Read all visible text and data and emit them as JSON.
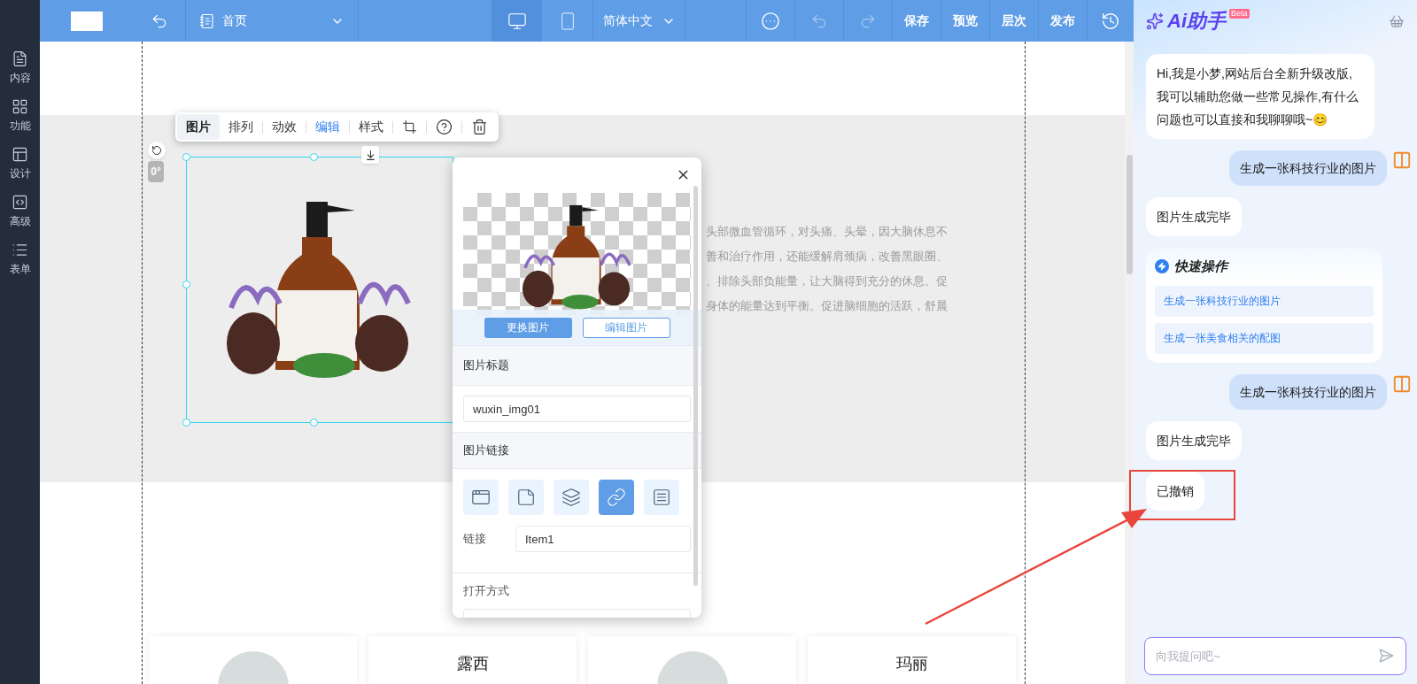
{
  "topbar": {
    "page_select": {
      "label": "首页"
    },
    "devices": [
      {
        "kind": "desktop",
        "selected": true
      },
      {
        "kind": "mobile",
        "selected": false
      }
    ],
    "language": "简体中文",
    "history": [
      {
        "kind": "undo",
        "disabled": true
      },
      {
        "kind": "redo",
        "disabled": true
      }
    ],
    "actions": [
      "保存",
      "预览",
      "层次",
      "发布"
    ]
  },
  "sidebar": {
    "items": [
      {
        "kind": "content",
        "label": "内容"
      },
      {
        "kind": "feature",
        "label": "功能"
      },
      {
        "kind": "design",
        "label": "设计"
      },
      {
        "kind": "advanced",
        "label": "高级"
      },
      {
        "kind": "form",
        "label": "表单"
      }
    ]
  },
  "canvas": {
    "body_text": [
      "头部微血管循环，对头痛、头晕，因大脑休息不",
      "善和治疗作用，还能缓解肩颈病，改善黑眼圈、",
      "、排除头部负能量，让大脑得到充分的休息。促",
      "身体的能量达到平衡。促进脑细胞的活跃，舒晨"
    ],
    "toolbar": [
      {
        "kind": "text",
        "label": "图片",
        "selected": true,
        "highlighted": false
      },
      {
        "kind": "text",
        "label": "排列",
        "selected": false,
        "highlighted": false
      },
      {
        "kind": "text",
        "label": "动效",
        "selected": false,
        "highlighted": false
      },
      {
        "kind": "text",
        "label": "编辑",
        "selected": false,
        "highlighted": true
      },
      {
        "kind": "text",
        "label": "样式",
        "selected": false,
        "highlighted": false
      },
      {
        "kind": "crop",
        "selected": false,
        "highlighted": false
      },
      {
        "kind": "help",
        "selected": false,
        "highlighted": false
      },
      {
        "kind": "delete",
        "selected": false,
        "highlighted": false
      }
    ],
    "rotation": "0°",
    "cards": [
      {
        "kind": "photo"
      },
      {
        "kind": "name",
        "name": "露西"
      },
      {
        "kind": "photo"
      },
      {
        "kind": "name",
        "name": "玛丽"
      }
    ]
  },
  "image_panel": {
    "buttons": [
      {
        "label": "更换图片",
        "primary": true
      },
      {
        "label": "编辑图片",
        "primary": false
      }
    ],
    "title_section": "图片标题",
    "title_value": "wuxin_img01",
    "link_section": "图片链接",
    "link_types": [
      {
        "kind": "page",
        "selected": false
      },
      {
        "kind": "article",
        "selected": false
      },
      {
        "kind": "layers",
        "selected": false
      },
      {
        "kind": "link",
        "selected": true
      },
      {
        "kind": "list",
        "selected": false
      }
    ],
    "link_field": {
      "label": "链接",
      "value": "Item1"
    },
    "open_section": "打开方式"
  },
  "assistant": {
    "title": "Ai助手",
    "badge": "Beta",
    "messages": [
      {
        "kind": "bot",
        "text": "Hi,我是小梦,网站后台全新升级改版,我可以辅助您做一些常见操作,有什么问题也可以直接和我聊聊哦~😊"
      },
      {
        "kind": "user",
        "text": "生成一张科技行业的图片"
      },
      {
        "kind": "bot",
        "text": "图片生成完毕"
      },
      {
        "kind": "quick",
        "title": "快速操作",
        "items": [
          "生成一张科技行业的图片",
          "生成一张美食相关的配图"
        ]
      },
      {
        "kind": "user",
        "text": "生成一张科技行业的图片"
      },
      {
        "kind": "bot",
        "text": "图片生成完毕"
      },
      {
        "kind": "bot",
        "text": "已撤销"
      }
    ],
    "input": {
      "placeholder": "向我提问吧~"
    }
  }
}
